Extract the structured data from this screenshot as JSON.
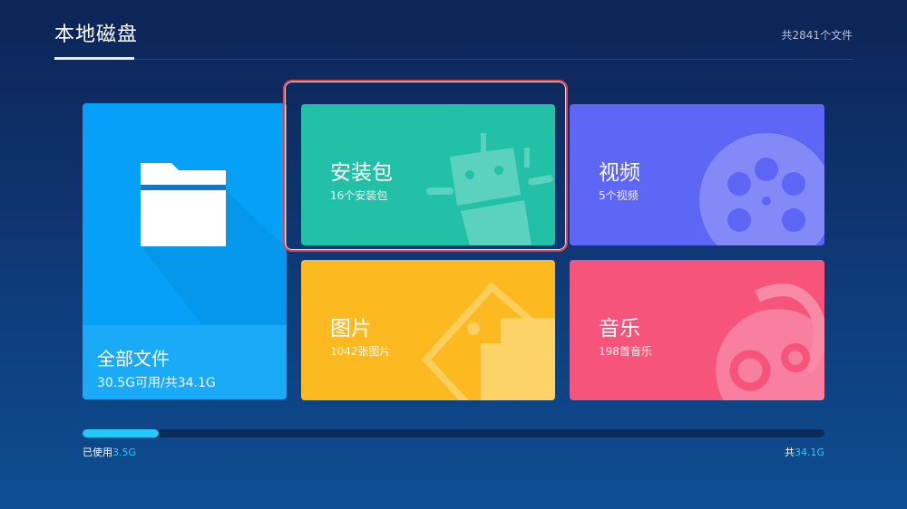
{
  "header": {
    "title": "本地磁盘",
    "file_count": "共2841个文件"
  },
  "tiles": {
    "all_files": {
      "name": "全部文件",
      "sub": "30.5G可用/共34.1G",
      "icon": "folder-icon",
      "color": "#06a0f8"
    },
    "apk": {
      "name": "安装包",
      "sub": "16个安装包",
      "icon": "android-icon",
      "color": "#22c0a6"
    },
    "video": {
      "name": "视频",
      "sub": "5个视频",
      "icon": "film-reel-icon",
      "color": "#5d66f5"
    },
    "image": {
      "name": "图片",
      "sub": "1042张图片",
      "icon": "image-tag-icon",
      "color": "#fcb920"
    },
    "music": {
      "name": "音乐",
      "sub": "198首音乐",
      "icon": "music-note-icon",
      "color": "#f6547a"
    }
  },
  "storage": {
    "used_prefix": "已使用",
    "used_value": "3.5G",
    "total_prefix": "共",
    "total_value": "34.1G",
    "used_fraction": 0.1026,
    "fill_color": "#25c8f7"
  },
  "focused_tile": "apk"
}
